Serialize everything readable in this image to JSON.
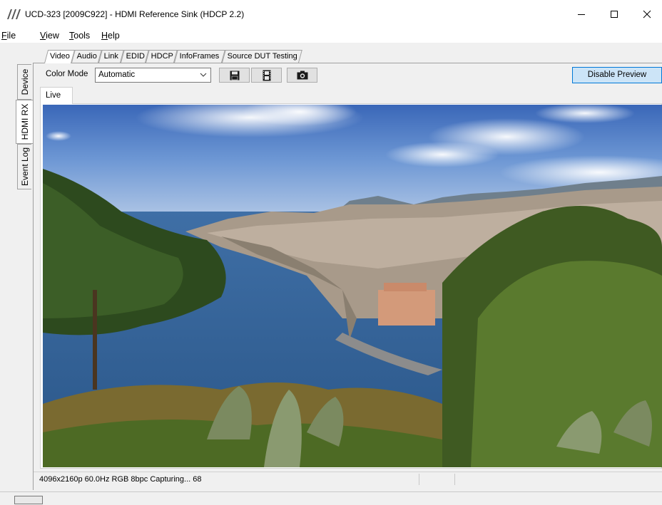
{
  "window": {
    "title": "UCD-323 [2009C922] - HDMI Reference Sink (HDCP 2.2)"
  },
  "menu": {
    "items": [
      {
        "label": "File",
        "mnemonic": "F",
        "rest": "ile"
      },
      {
        "label": "View",
        "mnemonic": "V",
        "rest": "iew"
      },
      {
        "label": "Tools",
        "mnemonic": "T",
        "rest": "ools"
      },
      {
        "label": "Help",
        "mnemonic": "H",
        "rest": "elp"
      }
    ]
  },
  "side_tabs": [
    {
      "label": "Device"
    },
    {
      "label": "HDMI RX",
      "active": true
    },
    {
      "label": "Event Log"
    }
  ],
  "top_tabs": [
    {
      "label": "Video",
      "active": true
    },
    {
      "label": "Audio"
    },
    {
      "label": "Link"
    },
    {
      "label": "EDID"
    },
    {
      "label": "HDCP"
    },
    {
      "label": "InfoFrames"
    },
    {
      "label": "Source DUT Testing"
    }
  ],
  "toolbar": {
    "color_mode_label": "Color Mode",
    "color_mode_value": "Automatic",
    "save_icon": "floppy-disk-icon",
    "record_icon": "film-strip-icon",
    "snapshot_icon": "camera-icon",
    "disable_preview_label": "Disable Preview"
  },
  "preview": {
    "sub_tab_label": "Live",
    "content": "landscape-photo"
  },
  "status": {
    "text": "4096x2160p 60.0Hz RGB 8bpc Capturing... 68"
  },
  "colors": {
    "accent_button_bg": "#cce4f7",
    "accent_button_border": "#0078d7"
  }
}
